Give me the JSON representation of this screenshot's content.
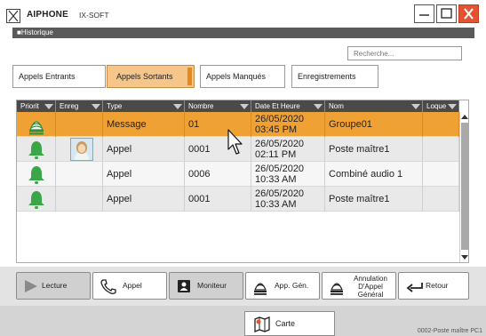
{
  "window": {
    "brand": "AIPHONE",
    "product": "IX-SOFT"
  },
  "section": {
    "title": "■Historique"
  },
  "search": {
    "placeholder": "Recherche..."
  },
  "tabs": [
    {
      "label": "Appels Entrants",
      "active": false
    },
    {
      "label": "Appels Sortants",
      "active": true
    },
    {
      "label": "Appels Manqués",
      "active": false
    },
    {
      "label": "Enregistrements",
      "active": false
    }
  ],
  "table": {
    "columns": [
      "Priorit",
      "Enreg",
      "Type",
      "Nombre",
      "Date Et Heure",
      "Nom",
      "Loque"
    ],
    "rows": [
      {
        "priority_icon": "broadcast-icon",
        "recording": "",
        "type": "Message",
        "number": "01",
        "date": "26/05/2020",
        "time": "03:45 PM",
        "name": "Groupe01",
        "selected": true
      },
      {
        "priority_icon": "bell-icon",
        "recording": "snapshot",
        "type": "Appel",
        "number": "0001",
        "date": "26/05/2020",
        "time": "02:11 PM",
        "name": "Poste maître1",
        "selected": false
      },
      {
        "priority_icon": "bell-icon",
        "recording": "",
        "type": "Appel",
        "number": "0006",
        "date": "26/05/2020",
        "time": "10:33 AM",
        "name": "Combiné audio 1",
        "selected": false
      },
      {
        "priority_icon": "bell-icon",
        "recording": "",
        "type": "Appel",
        "number": "0001",
        "date": "26/05/2020",
        "time": "10:33 AM",
        "name": "Poste maître1",
        "selected": false
      }
    ]
  },
  "actions": {
    "lecture": "Lecture",
    "appel": "Appel",
    "moniteur": "Moniteur",
    "app_gen": "App. Gén.",
    "annulation_1": "Annulation",
    "annulation_2": "D'Appel",
    "annulation_3": "Général",
    "retour": "Retour",
    "carte": "Carte"
  },
  "status": {
    "station": "0002-Poste maître PC1"
  },
  "colors": {
    "selected_row": "#efa133",
    "active_tab": "#f5c58a",
    "bell_green": "#3aa648",
    "close_red": "#e4532f"
  }
}
